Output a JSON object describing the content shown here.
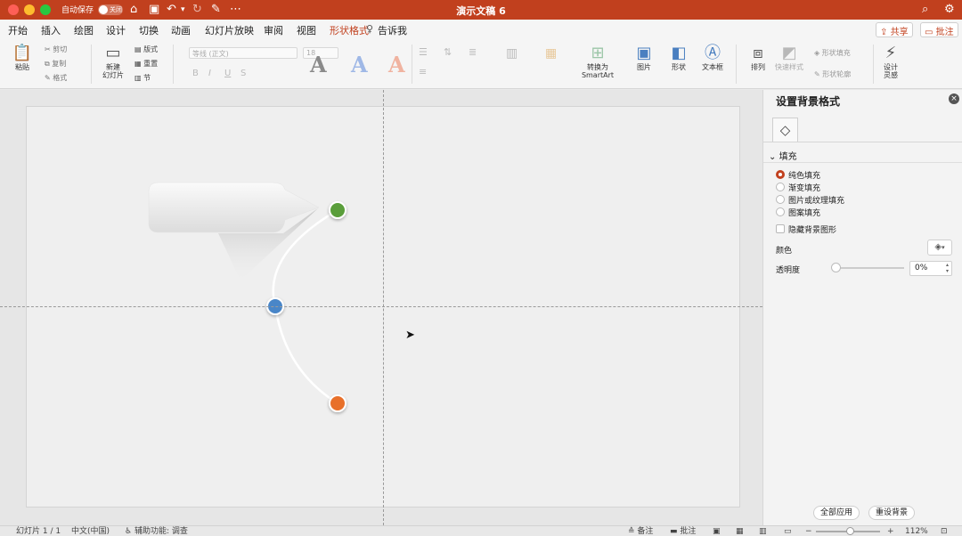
{
  "titlebar": {
    "autosave_label": "自动保存",
    "autosave_state": "关闭",
    "document_title": "演示文稿 6",
    "accent_color": "#c1401e"
  },
  "tabs": [
    "开始",
    "插入",
    "绘图",
    "设计",
    "切换",
    "动画",
    "幻灯片放映",
    "审阅",
    "视图",
    "形状格式",
    "告诉我"
  ],
  "active_tab": "动画",
  "contextual_tab": "形状格式",
  "header_buttons": {
    "share": "共享",
    "comment": "批注"
  },
  "toolbar": {
    "paste": "粘贴",
    "cut": "剪切",
    "copy": "复制",
    "format": "格式",
    "new_slide_line1": "新建",
    "new_slide_line2": "幻灯片",
    "layout": "版式",
    "reset": "重置",
    "section": "节",
    "font_name": "等线 (正文)",
    "font_size": "18",
    "convert_smartart_line1": "转换为",
    "convert_smartart_line2": "SmartArt",
    "picture": "图片",
    "shapes": "形状",
    "text_box": "文本框",
    "arrange": "排列",
    "quick_styles": "快速样式",
    "shape_fill": "形状填充",
    "shape_outline": "形状轮廓",
    "design_ideas_line1": "设计",
    "design_ideas_line2": "灵感"
  },
  "slide": {
    "dots": [
      {
        "name": "green",
        "color": "#5a9e3a"
      },
      {
        "name": "blue",
        "color": "#4a86c8"
      },
      {
        "name": "orange",
        "color": "#e8702a"
      }
    ]
  },
  "format_pane": {
    "title": "设置背景格式",
    "section": "填充",
    "fill_options": [
      {
        "label": "纯色填充",
        "selected": true
      },
      {
        "label": "渐变填充",
        "selected": false
      },
      {
        "label": "图片或纹理填充",
        "selected": false
      },
      {
        "label": "图案填充",
        "selected": false
      }
    ],
    "hide_background_graphics": "隐藏背景图形",
    "color_label": "颜色",
    "transparency_label": "透明度",
    "transparency_value": "0%",
    "transparency_fraction": 0,
    "apply_all": "全部应用",
    "reset_background": "重设背景"
  },
  "statusbar": {
    "slide_info": "幻灯片 1 / 1",
    "language": "中文(中国)",
    "accessibility": "辅助功能: 调查",
    "notes": "备注",
    "comments": "批注",
    "zoom": "112%"
  }
}
